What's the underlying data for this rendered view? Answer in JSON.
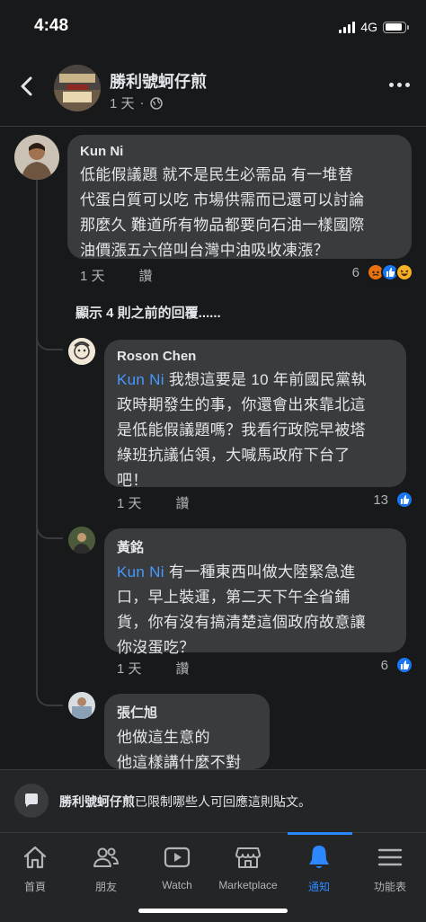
{
  "status_bar": {
    "time": "4:48",
    "network": "4G",
    "battery_level": 0.9
  },
  "header": {
    "page_name": "勝利號蚵仔煎",
    "time": "1 天"
  },
  "comments": [
    {
      "author": "Kun Ni",
      "text_lines": [
        "低能假議題 就不是民生必需品 有一堆替",
        "代蛋白質可以吃 市場供需而已還可以討論",
        "那麼久 難道所有物品都要向石油一樣國際",
        "油價漲五六倍叫台灣中油吸收凍漲？"
      ],
      "time": "1 天",
      "like_label": "讚",
      "reaction_count": "6"
    }
  ],
  "show_previous": "顯示 4 則之前的回覆......",
  "replies": [
    {
      "author": "Roson Chen",
      "mention": "Kun Ni",
      "text_lines": [
        "我想這要是 10 年前國民黨執",
        "政時期發生的事，你還會出來靠北這",
        "是低能假議題嗎？我看行政院早被塔",
        "綠班抗議佔領，大喊馬政府下台了",
        "吧！"
      ],
      "time": "1 天",
      "like_label": "讚",
      "reaction_count": "13"
    },
    {
      "author": "黃銘",
      "mention": "Kun Ni",
      "text_lines": [
        "有一種東西叫做大陸緊急進",
        "口，早上裝運，第二天下午全省鋪",
        "貨，你有沒有搞清楚這個政府故意讓",
        "你沒蛋吃？"
      ],
      "time": "1 天",
      "like_label": "讚",
      "reaction_count": "6"
    },
    {
      "author": "張仁旭",
      "text_lines": [
        "他做這生意的",
        "他這樣講什麼不對"
      ]
    }
  ],
  "restriction": {
    "page_name": "勝利號蚵仔煎",
    "message": "已限制哪些人可回應這則貼文。"
  },
  "nav": [
    {
      "label": "首頁",
      "icon": "home-icon"
    },
    {
      "label": "朋友",
      "icon": "friends-icon"
    },
    {
      "label": "Watch",
      "icon": "watch-icon"
    },
    {
      "label": "Marketplace",
      "icon": "marketplace-icon"
    },
    {
      "label": "通知",
      "icon": "bell-icon",
      "active": true
    },
    {
      "label": "功能表",
      "icon": "menu-icon"
    }
  ],
  "colors": {
    "accent": "#2d88ff",
    "mention": "#4599ff",
    "background": "#18191a",
    "bubble": "#3a3b3c"
  }
}
